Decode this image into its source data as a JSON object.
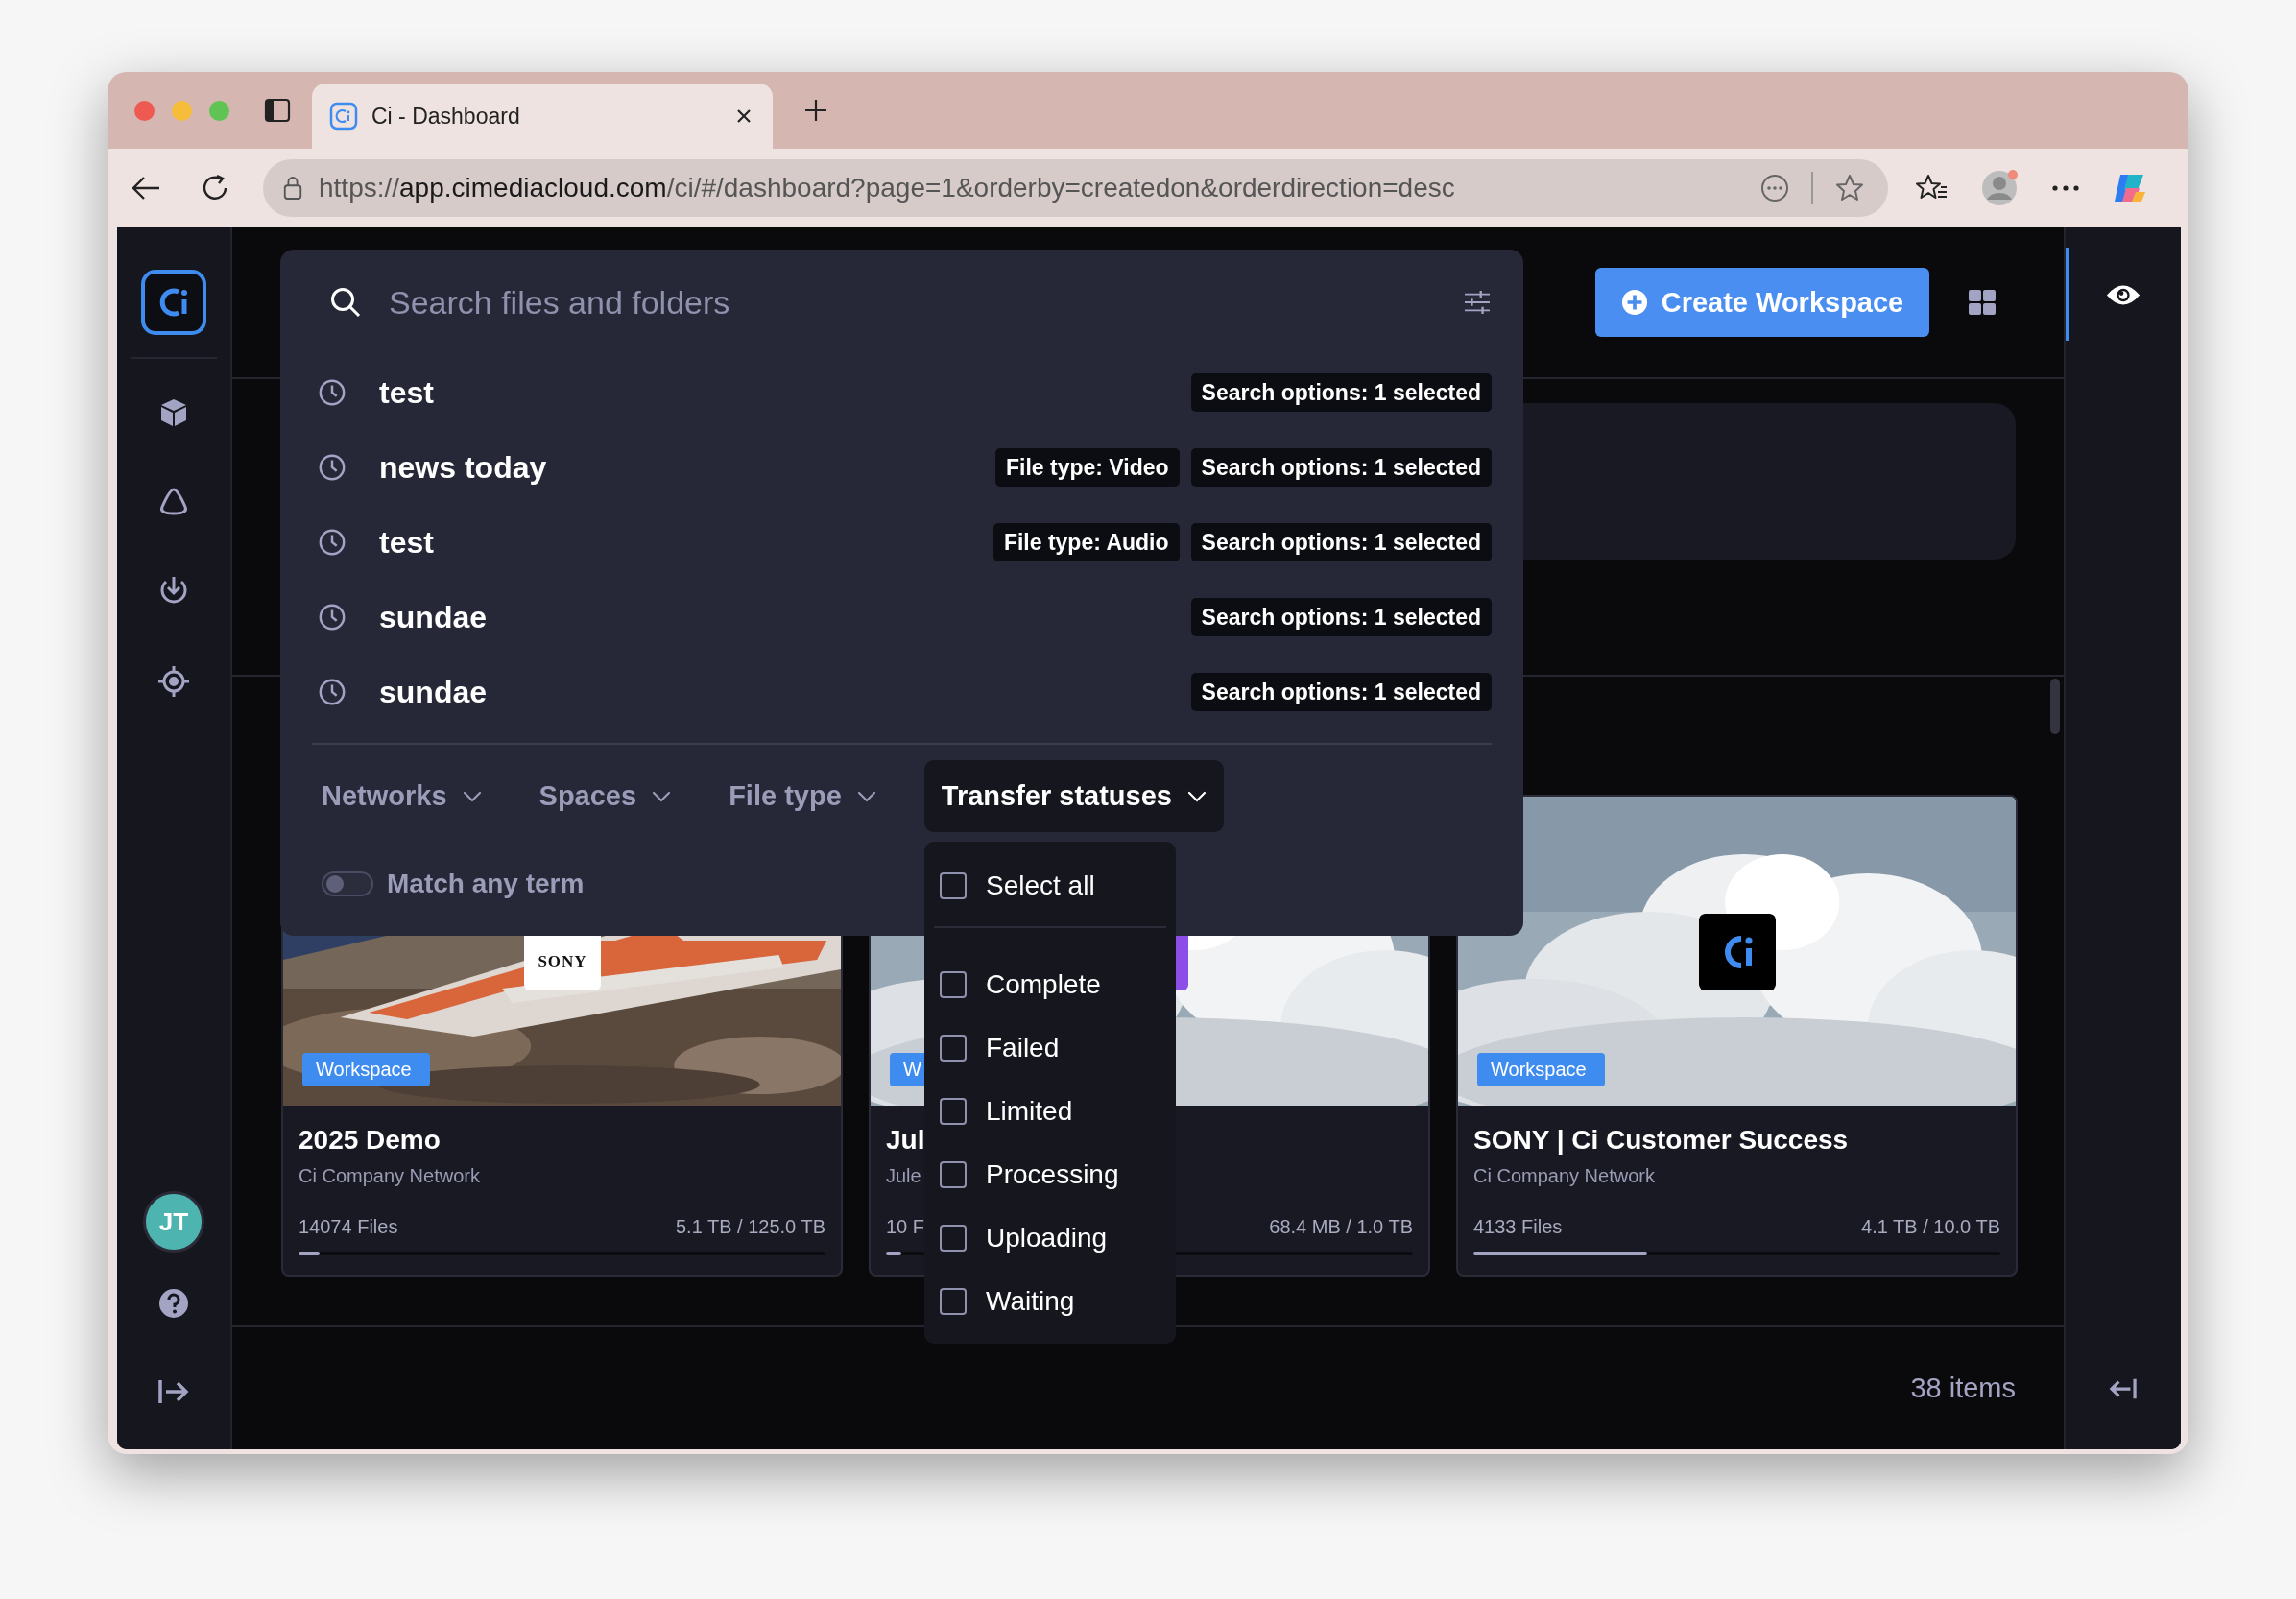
{
  "browser": {
    "tab_title": "Ci - Dashboard",
    "url": {
      "scheme": "https://",
      "host": "app.cimediacloud.com",
      "path": "/ci/#/dashboard?page=1&orderby=createdon&orderdirection=desc"
    }
  },
  "sidebar": {
    "avatar": "JT"
  },
  "header": {
    "create_button": "Create Workspace"
  },
  "search": {
    "placeholder": "Search files and folders",
    "recent": [
      {
        "query": "test",
        "chips": [
          "Search options: 1 selected"
        ]
      },
      {
        "query": "news today",
        "chips": [
          "File type: Video",
          "Search options: 1 selected"
        ]
      },
      {
        "query": "test",
        "chips": [
          "File type: Audio",
          "Search options: 1 selected"
        ]
      },
      {
        "query": "sundae",
        "chips": [
          "Search options: 1 selected"
        ]
      },
      {
        "query": "sundae",
        "chips": [
          "Search options: 1 selected"
        ]
      }
    ],
    "filters": [
      {
        "label": "Networks",
        "selected": false
      },
      {
        "label": "Spaces",
        "selected": false
      },
      {
        "label": "File type",
        "selected": false
      },
      {
        "label": "Transfer statuses",
        "selected": true
      }
    ],
    "match_any_term": {
      "label": "Match any term",
      "on": false
    }
  },
  "transfer_status_menu": {
    "select_all": {
      "label": "Select all",
      "checked": false
    },
    "options": [
      {
        "label": "Complete",
        "checked": false
      },
      {
        "label": "Failed",
        "checked": false
      },
      {
        "label": "Limited",
        "checked": false
      },
      {
        "label": "Processing",
        "checked": false
      },
      {
        "label": "Uploading",
        "checked": false
      },
      {
        "label": "Waiting",
        "checked": false
      }
    ]
  },
  "cards": [
    {
      "badge": "Workspace",
      "title": "2025 Demo",
      "network": "Ci Company Network",
      "files": "14074 Files",
      "storage": "5.1 TB / 125.0 TB",
      "level": 0.04,
      "logo": {
        "kind": "text",
        "text": "SONY"
      }
    },
    {
      "badge": "W",
      "title": "Jul",
      "network": "Jule",
      "files": "10 F",
      "storage": "68.4 MB / 1.0 TB",
      "level": 0.03,
      "logo": {
        "kind": "block"
      }
    },
    {
      "badge": "Workspace",
      "title": "SONY | Ci Customer Success",
      "network": "Ci Company Network",
      "files": "4133 Files",
      "storage": "4.1 TB / 10.0 TB",
      "level": 0.33,
      "logo": {
        "kind": "ci"
      }
    }
  ],
  "footer": {
    "count": "38 items"
  }
}
